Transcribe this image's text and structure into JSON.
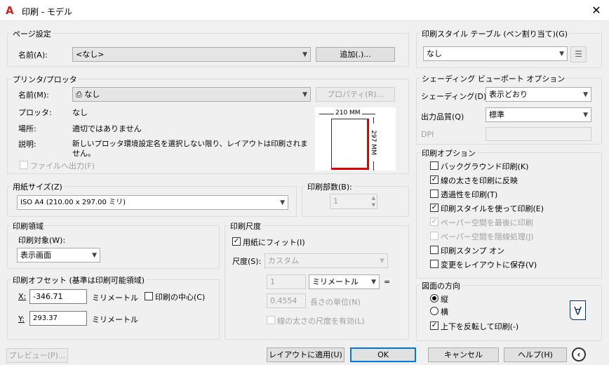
{
  "window": {
    "title": "印刷 - モデル",
    "app_icon": "A"
  },
  "page_setup": {
    "group": "ページ設定",
    "name_label": "名前(A):",
    "name_value": "<なし>",
    "add_button": "追加(.)..."
  },
  "printer": {
    "group": "プリンタ/プロッタ",
    "name_label": "名前(M):",
    "name_value": "なし",
    "properties_button": "プロパティ(R)...",
    "plotter_label": "プロッタ:",
    "plotter_value": "なし",
    "where_label": "場所:",
    "where_value": "適切ではありません",
    "desc_label": "説明:",
    "desc_value_1": "新しいプロッタ環境設定名を選択しない限り、レイアウトは印刷されま",
    "desc_value_2": "せん。",
    "print_to_file": "ファイルへ出力(F)",
    "preview_width": "210 MM",
    "preview_height": "297 MM"
  },
  "paper_size": {
    "group": "用紙サイズ(Z)",
    "value": "ISO A4 (210.00 x 297.00 ミリ)"
  },
  "copies": {
    "group": "印刷部数(B):",
    "value": "1"
  },
  "plot_area": {
    "group": "印刷領域",
    "what_label": "印刷対象(W):",
    "what_value": "表示画面"
  },
  "plot_offset": {
    "group": "印刷オフセット (基準は印刷可能領域)",
    "x_label": "X:",
    "x_value": "-346.71",
    "x_unit": "ミリメートル",
    "y_label": "Y:",
    "y_value": "293.37",
    "y_unit": "ミリメートル",
    "center": "印刷の中心(C)"
  },
  "plot_scale": {
    "group": "印刷尺度",
    "fit": "用紙にフィット(I)",
    "fit_checked": true,
    "scale_label": "尺度(S):",
    "scale_value": "カスタム",
    "value1": "1",
    "unit": "ミリメートル",
    "equals": "=",
    "value2": "0.4554",
    "unit2": "長さの単位(N)",
    "lineweights": "線の太さの尺度を有効(L)"
  },
  "plot_style_table": {
    "group": "印刷スタイル テーブル (ペン割り当て)(G)",
    "value": "なし"
  },
  "shaded": {
    "group": "シェーディング ビューポート オプション",
    "shade_label": "シェーディング(D)",
    "shade_value": "表示どおり",
    "quality_label": "出力品質(Q)",
    "quality_value": "標準",
    "dpi_label": "DPI"
  },
  "plot_options": {
    "group": "印刷オプション",
    "items": [
      {
        "label": "バックグラウンド印刷(K)",
        "checked": false,
        "disabled": false
      },
      {
        "label": "線の太さを印刷に反映",
        "checked": true,
        "disabled": false
      },
      {
        "label": "透過性を印刷(T)",
        "checked": false,
        "disabled": false
      },
      {
        "label": "印刷スタイルを使って印刷(E)",
        "checked": true,
        "disabled": false
      },
      {
        "label": "ペーパー空間を最後に印刷",
        "checked": true,
        "disabled": true
      },
      {
        "label": "ペーパー空間を隠線処理(J)",
        "checked": false,
        "disabled": true
      },
      {
        "label": "印刷スタンプ オン",
        "checked": false,
        "disabled": false
      },
      {
        "label": "変更をレイアウトに保存(V)",
        "checked": false,
        "disabled": false
      }
    ]
  },
  "orientation": {
    "group": "図面の方向",
    "portrait": "縦",
    "landscape": "横",
    "upside_down": "上下を反転して印刷(-)",
    "selected": "portrait",
    "upside_down_checked": true,
    "icon_letter": "A"
  },
  "footer": {
    "preview": "プレビュー(P)...",
    "apply": "レイアウトに適用(U)",
    "ok": "OK",
    "cancel": "キャンセル",
    "help": "ヘルプ(H)"
  },
  "colors": {
    "accent": "#0078d7",
    "paper_edge": "#e00000",
    "title_icon": "#d21f1f"
  }
}
